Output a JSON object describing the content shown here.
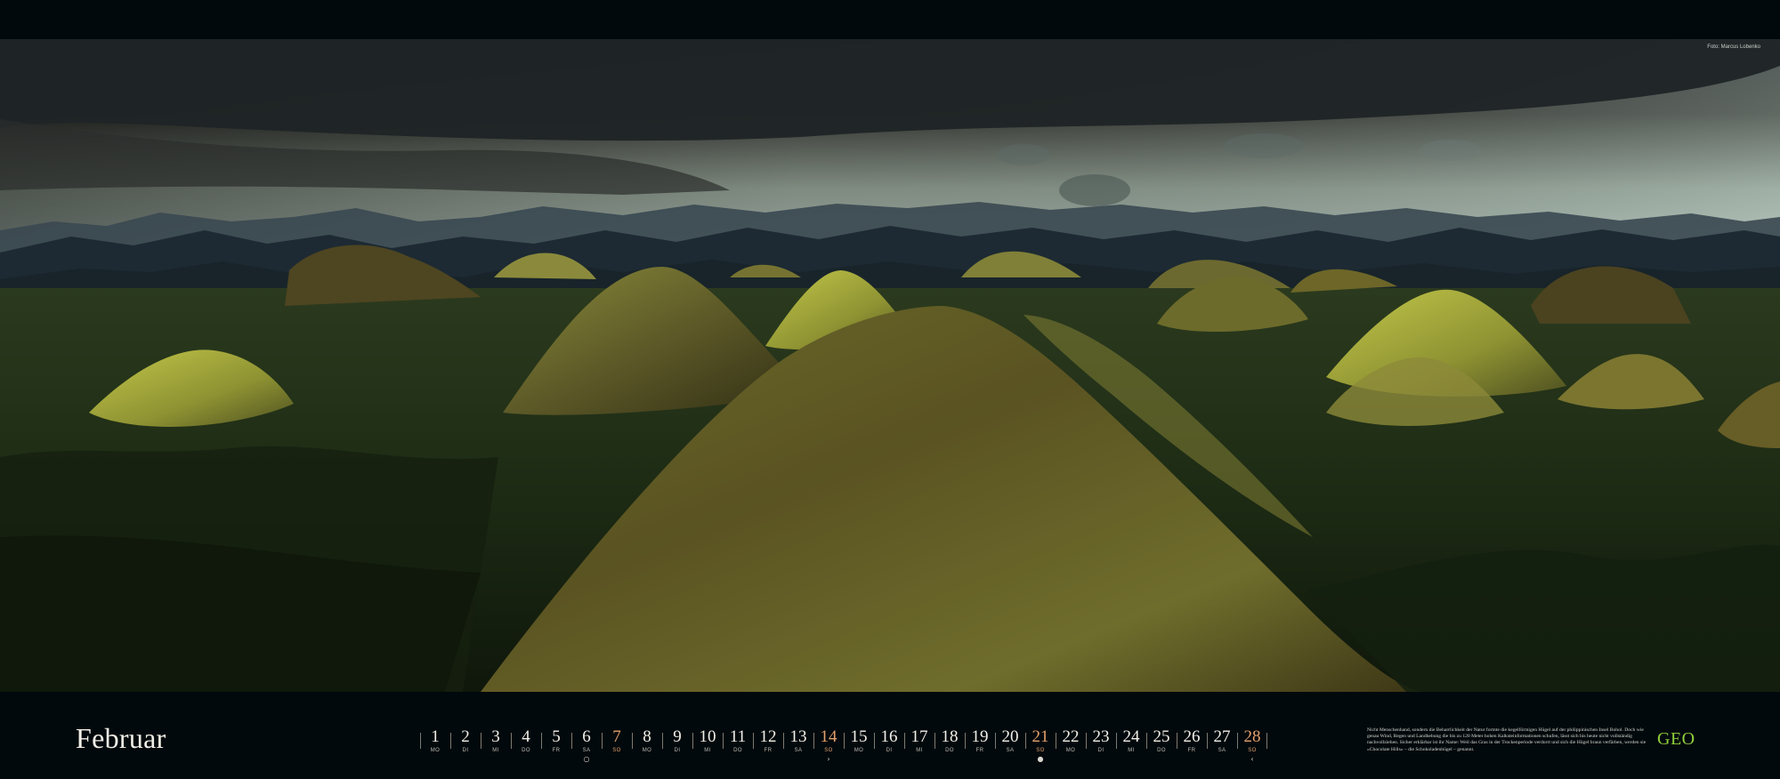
{
  "photo": {
    "credit": "Foto: Marcus Lobenko"
  },
  "calendar": {
    "month": "Februar",
    "days": [
      {
        "num": "1",
        "wd": "MO",
        "sunday": false,
        "moon": ""
      },
      {
        "num": "2",
        "wd": "DI",
        "sunday": false,
        "moon": ""
      },
      {
        "num": "3",
        "wd": "MI",
        "sunday": false,
        "moon": ""
      },
      {
        "num": "4",
        "wd": "DO",
        "sunday": false,
        "moon": ""
      },
      {
        "num": "5",
        "wd": "FR",
        "sunday": false,
        "moon": ""
      },
      {
        "num": "6",
        "wd": "SA",
        "sunday": false,
        "moon": "○"
      },
      {
        "num": "7",
        "wd": "SO",
        "sunday": true,
        "moon": ""
      },
      {
        "num": "8",
        "wd": "MO",
        "sunday": false,
        "moon": ""
      },
      {
        "num": "9",
        "wd": "DI",
        "sunday": false,
        "moon": ""
      },
      {
        "num": "10",
        "wd": "MI",
        "sunday": false,
        "moon": ""
      },
      {
        "num": "11",
        "wd": "DO",
        "sunday": false,
        "moon": ""
      },
      {
        "num": "12",
        "wd": "FR",
        "sunday": false,
        "moon": ""
      },
      {
        "num": "13",
        "wd": "SA",
        "sunday": false,
        "moon": ""
      },
      {
        "num": "14",
        "wd": "SO",
        "sunday": true,
        "moon": "›"
      },
      {
        "num": "15",
        "wd": "MO",
        "sunday": false,
        "moon": ""
      },
      {
        "num": "16",
        "wd": "DI",
        "sunday": false,
        "moon": ""
      },
      {
        "num": "17",
        "wd": "MI",
        "sunday": false,
        "moon": ""
      },
      {
        "num": "18",
        "wd": "DO",
        "sunday": false,
        "moon": ""
      },
      {
        "num": "19",
        "wd": "FR",
        "sunday": false,
        "moon": ""
      },
      {
        "num": "20",
        "wd": "SA",
        "sunday": false,
        "moon": ""
      },
      {
        "num": "21",
        "wd": "SO",
        "sunday": true,
        "moon": "●"
      },
      {
        "num": "22",
        "wd": "MO",
        "sunday": false,
        "moon": ""
      },
      {
        "num": "23",
        "wd": "DI",
        "sunday": false,
        "moon": ""
      },
      {
        "num": "24",
        "wd": "MI",
        "sunday": false,
        "moon": ""
      },
      {
        "num": "25",
        "wd": "DO",
        "sunday": false,
        "moon": ""
      },
      {
        "num": "26",
        "wd": "FR",
        "sunday": false,
        "moon": ""
      },
      {
        "num": "27",
        "wd": "SA",
        "sunday": false,
        "moon": ""
      },
      {
        "num": "28",
        "wd": "SO",
        "sunday": true,
        "moon": "‹"
      }
    ]
  },
  "caption": {
    "text": "Nicht Menschenhand, sondern die Beharrlichkeit der Natur formte die kegelförmigen Hügel auf der philippinischen Insel Bohol. Doch wie genau Wind, Regen und Landhebung die bis zu 120 Meter hohen Kalksteinformationen schufen, lässt sich bis heute nicht vollständig nachvollziehen. Sicher erklärbar ist ihr Name: Weil das Gras in der Trockenperiode verdorrt und sich die Hügel braun verfärben, werden sie »Chocolate Hills« – die Schokoladenhügel – genannt."
  },
  "brand": {
    "logo": "GEO",
    "color": "#8fcf3c"
  },
  "colors": {
    "sunday": "#e3a16d",
    "text": "#f1efe8",
    "background": "#02090c"
  }
}
